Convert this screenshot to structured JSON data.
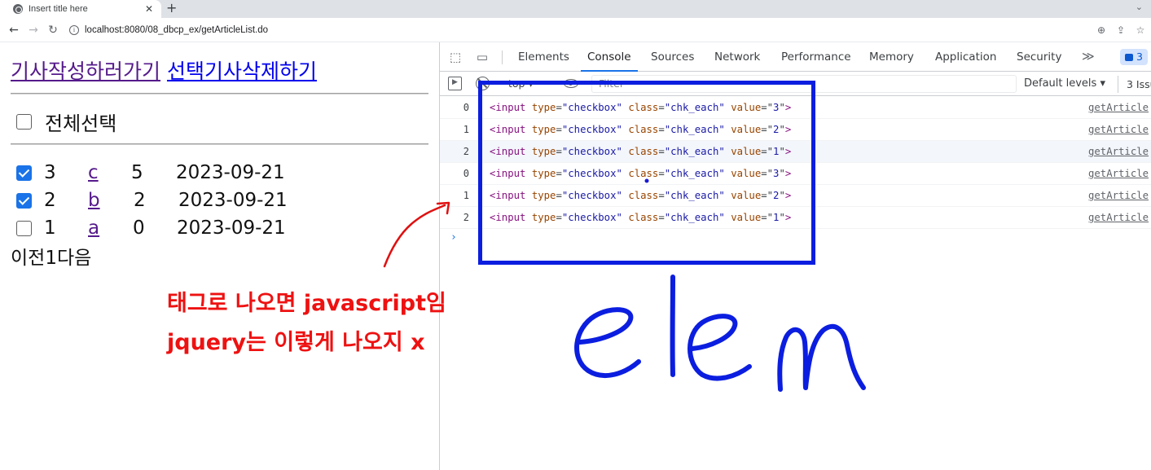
{
  "browser": {
    "tab_title": "Insert title here",
    "tab_close": "✕",
    "new_tab": "+",
    "tab_menu": "⌄",
    "url": "localhost:8080/08_dbcp_ex/getArticleList.do",
    "icons": [
      "back-icon",
      "forward-icon",
      "reload-icon",
      "site-info-icon",
      "zoom-icon",
      "share-icon",
      "bookmark-star-icon"
    ]
  },
  "page": {
    "link_write": "기사작성하러가기",
    "link_delete": "선택기사삭제하기",
    "select_all_label": "전체선택",
    "rows": [
      {
        "checked": true,
        "num": "3",
        "title": "c",
        "count": "5",
        "date": "2023-09-21"
      },
      {
        "checked": true,
        "num": "2",
        "title": "b",
        "count": "2",
        "date": "2023-09-21"
      },
      {
        "checked": false,
        "num": "1",
        "title": "a",
        "count": "0",
        "date": "2023-09-21"
      }
    ],
    "pager": "이전1다음"
  },
  "devtools": {
    "tabs": [
      "Elements",
      "Console",
      "Sources",
      "Network",
      "Performance",
      "Memory",
      "Application",
      "Security"
    ],
    "active_tab": "Console",
    "more": "≫",
    "badge_count": "3",
    "context": "top ▾",
    "filter_placeholder": "Filter",
    "levels": "Default levels ▾",
    "issues": "3 Issu",
    "logs": [
      {
        "idx": "0",
        "value": "3",
        "src": "getArticle"
      },
      {
        "idx": "1",
        "value": "2",
        "src": "getArticle"
      },
      {
        "idx": "2",
        "value": "1",
        "src": "getArticle"
      },
      {
        "idx": "0",
        "value": "3",
        "src": "getArticle"
      },
      {
        "idx": "1",
        "value": "2",
        "src": "getArticle"
      },
      {
        "idx": "2",
        "value": "1",
        "src": "getArticle"
      }
    ],
    "log_tag": {
      "open": "<input",
      "type_attr": "type",
      "type_val": "\"checkbox\"",
      "class_attr": "class",
      "class_val": "\"chk_each\"",
      "value_attr": "value",
      "close": ">"
    },
    "prompt": "›"
  },
  "annotations": {
    "note1": "태그로 나오면 javascript임",
    "note2": "jquery는 이렇게 나오지 x",
    "handwriting": "elem",
    "box_color": "#0b1ee0",
    "text_color": "#ee1111"
  }
}
